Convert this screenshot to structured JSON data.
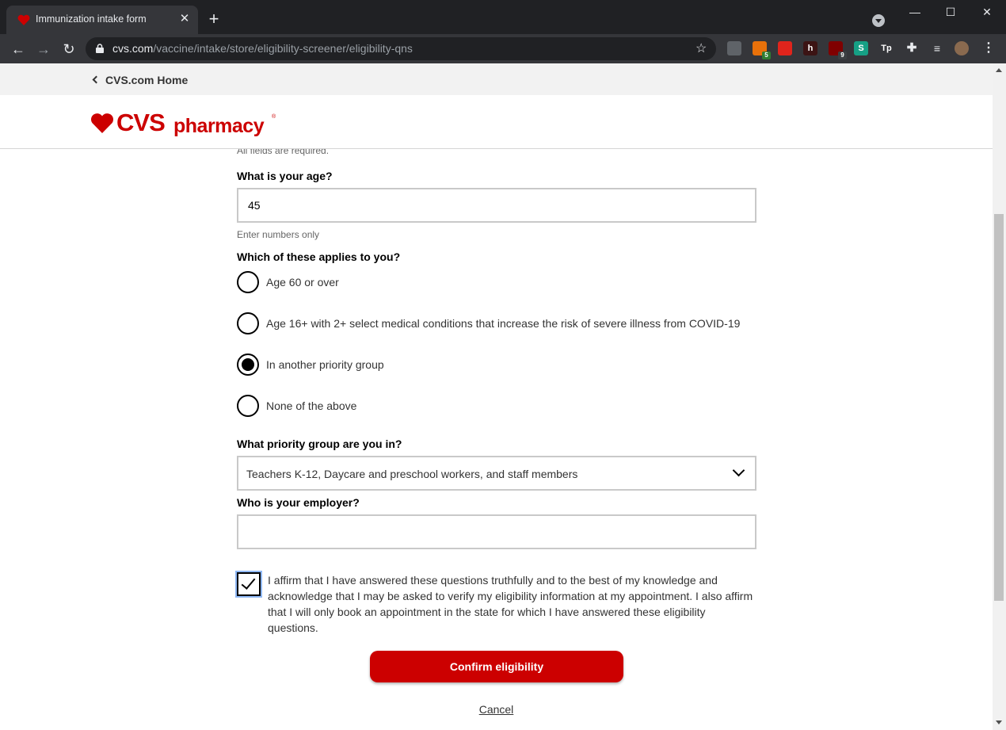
{
  "browser": {
    "tab_title": "Immunization intake form",
    "tab_close": "✕",
    "new_tab": "+",
    "url_host": "cvs.com",
    "url_path": "/vaccine/intake/store/eligibility-screener/eligibility-qns",
    "window_minimize": "—",
    "window_maximize": "☐",
    "window_close": "✕",
    "extensions": [
      {
        "name": "extension-icon-gray",
        "color": "#5f6368",
        "label": ""
      },
      {
        "name": "extension-icon-orange",
        "color": "#e8710a",
        "label": "",
        "badge": "5"
      },
      {
        "name": "extension-icon-red-shield",
        "color": "#e0241c",
        "label": ""
      },
      {
        "name": "extension-icon-h",
        "color": "#3c1414",
        "label": "h"
      },
      {
        "name": "ublock-origin-icon",
        "color": "#800000",
        "label": "",
        "badge": "9"
      },
      {
        "name": "extension-icon-s",
        "color": "#16a085",
        "label": "S"
      },
      {
        "name": "extension-icon-tp",
        "color": "#35363a",
        "label": "Tp"
      }
    ]
  },
  "page": {
    "back_link": "CVS.com Home",
    "logo_brand": "CVS",
    "logo_suffix": "pharmacy",
    "logo_reg": "®",
    "required_note": "All fields are required.",
    "age_question": "What is your age?",
    "age_value": "45",
    "age_hint": "Enter numbers only",
    "applies_question": "Which of these applies to you?",
    "options": [
      {
        "label": "Age 60 or over",
        "checked": false
      },
      {
        "label": "Age 16+ with 2+ select medical conditions that increase the risk of severe illness from COVID-19",
        "checked": false
      },
      {
        "label": "In another priority group",
        "checked": true
      },
      {
        "label": "None of the above",
        "checked": false
      }
    ],
    "priority_question": "What priority group are you in?",
    "priority_value": "Teachers K-12, Daycare and preschool workers, and staff members",
    "employer_question": "Who is your employer?",
    "employer_value": "",
    "affirm_checked": true,
    "affirm_text": "I affirm that I have answered these questions truthfully and to the best of my knowledge and acknowledge that I may be asked to verify my eligibility information at my appointment. I also affirm that I will only book an appointment in the state for which I have answered these eligibility questions.",
    "confirm_button": "Confirm eligibility",
    "cancel_link": "Cancel",
    "brand_color": "#cc0000"
  }
}
